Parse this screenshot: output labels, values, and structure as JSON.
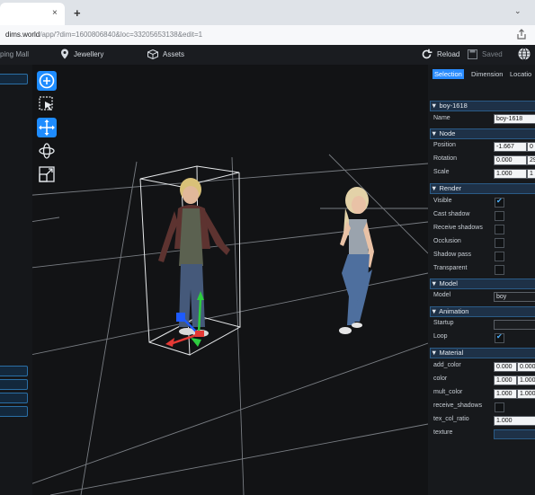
{
  "browser": {
    "url_host": "dims.world",
    "url_rest": "/app/?dim=1600806840&loc=33205653138&edit=1",
    "new_tab_glyph": "+",
    "tab_close_glyph": "×",
    "tab_menu_glyph": "⌄"
  },
  "appbar": {
    "menu_partial": "ping Mall",
    "jewellery": "Jewellery",
    "assets": "Assets",
    "reload": "Reload",
    "saved": "Saved"
  },
  "tabs": [
    "Selection",
    "Dimension",
    "Locatio"
  ],
  "sections": {
    "object": "boy-1618",
    "node": "Node",
    "render": "Render",
    "model": "Model",
    "animation": "Animation",
    "material": "Material"
  },
  "object": {
    "name_label": "Name",
    "name_value": "boy-1618"
  },
  "node": {
    "position_label": "Position",
    "position_x": "-1.667",
    "position_y": "0",
    "rotation_label": "Rotation",
    "rotation_x": "0.000",
    "rotation_y": "29",
    "scale_label": "Scale",
    "scale_x": "1.000",
    "scale_y": "1"
  },
  "render": {
    "visible": "Visible",
    "cast_shadow": "Cast shadow",
    "receive_shadows": "Receive shadows",
    "occlusion": "Occlusion",
    "shadow_pass": "Shadow pass",
    "transparent": "Transparent"
  },
  "model": {
    "label": "Model",
    "value": "boy"
  },
  "animation": {
    "startup": "Startup",
    "loop": "Loop"
  },
  "material": {
    "add_color": "add_color",
    "add_color_v1": "0.000",
    "add_color_v2": "0.000",
    "color": "color",
    "color_v1": "1.000",
    "color_v2": "1.000",
    "mult_color": "mult_color",
    "mult_color_v1": "1.000",
    "mult_color_v2": "1.000",
    "receive_shadows": "receive_shadows",
    "tex_col_ratio": "tex_col_ratio",
    "tex_col_ratio_v": "1.000",
    "texture": "texture"
  },
  "checks": {
    "visible": true,
    "cast_shadow": false,
    "receive_shadows": false,
    "occlusion": false,
    "shadow_pass": false,
    "transparent": false,
    "loop": true
  },
  "colors": {
    "accent": "#2a8cff",
    "panel_header": "#1e3147",
    "gizmo_x": "#e53935",
    "gizmo_y": "#2ecc40",
    "gizmo_z": "#1e5bff"
  },
  "icons": [
    "plus-circle-icon",
    "select-icon",
    "move-icon",
    "rotate-icon",
    "scale-icon",
    "reload-icon",
    "save-icon",
    "globe-icon",
    "diamond-icon",
    "box-icon",
    "share-icon"
  ]
}
